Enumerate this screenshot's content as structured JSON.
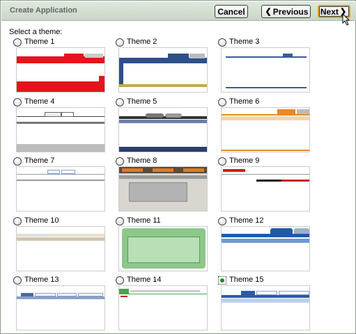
{
  "window": {
    "title": "Create Application"
  },
  "toolbar": {
    "cancel_label": "Cancel",
    "previous_label": "Previous",
    "next_label": "Next"
  },
  "prompt": "Select a theme:",
  "themes": [
    {
      "label": "Theme 1",
      "selected": false
    },
    {
      "label": "Theme 2",
      "selected": false
    },
    {
      "label": "Theme 3",
      "selected": false
    },
    {
      "label": "Theme 4",
      "selected": false
    },
    {
      "label": "Theme 5",
      "selected": false
    },
    {
      "label": "Theme 6",
      "selected": false
    },
    {
      "label": "Theme 7",
      "selected": false
    },
    {
      "label": "Theme 8",
      "selected": false
    },
    {
      "label": "Theme 9",
      "selected": false
    },
    {
      "label": "Theme 10",
      "selected": false
    },
    {
      "label": "Theme 11",
      "selected": false
    },
    {
      "label": "Theme 12",
      "selected": false
    },
    {
      "label": "Theme 13",
      "selected": false
    },
    {
      "label": "Theme 14",
      "selected": false
    },
    {
      "label": "Theme 15",
      "selected": true
    }
  ],
  "colors": {
    "title_bar": "#d3dfd1",
    "next_focus": "#e8a02a",
    "selected_radio": "#1c8a1c"
  }
}
